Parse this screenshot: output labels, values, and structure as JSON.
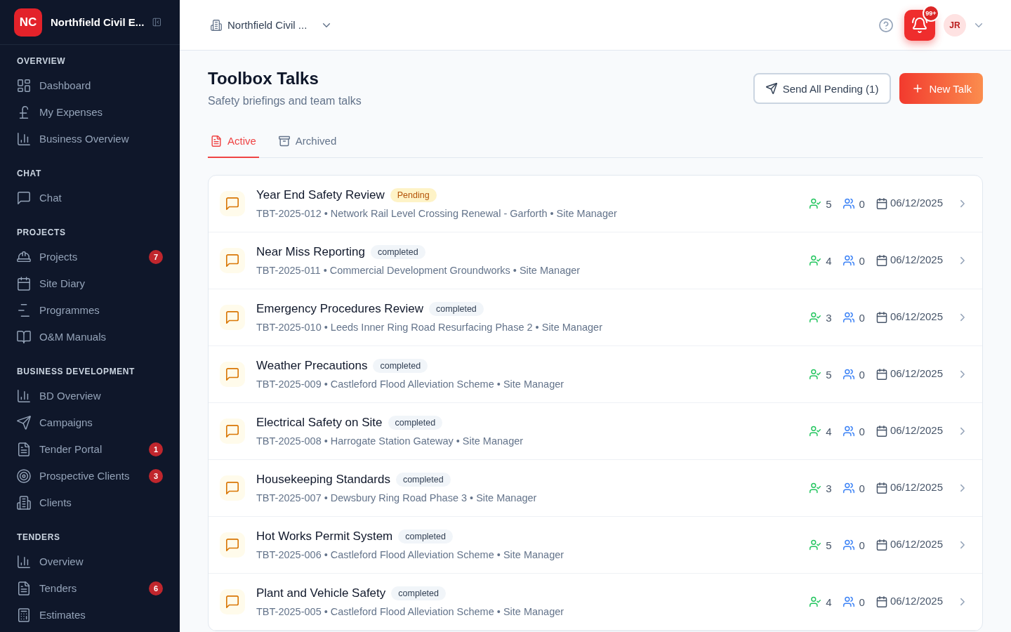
{
  "sidebar": {
    "brand": {
      "initials": "NC",
      "name": "Northfield Civil E..."
    },
    "sections": [
      {
        "heading": "OVERVIEW",
        "items": [
          {
            "label": "Dashboard"
          },
          {
            "label": "My Expenses"
          },
          {
            "label": "Business Overview"
          }
        ]
      },
      {
        "heading": "CHAT",
        "items": [
          {
            "label": "Chat"
          }
        ]
      },
      {
        "heading": "PROJECTS",
        "items": [
          {
            "label": "Projects",
            "badge": "7"
          },
          {
            "label": "Site Diary"
          },
          {
            "label": "Programmes"
          },
          {
            "label": "O&M Manuals"
          }
        ]
      },
      {
        "heading": "BUSINESS DEVELOPMENT",
        "items": [
          {
            "label": "BD Overview"
          },
          {
            "label": "Campaigns"
          },
          {
            "label": "Tender Portal",
            "badge": "1"
          },
          {
            "label": "Prospective Clients",
            "badge": "3"
          },
          {
            "label": "Clients"
          }
        ]
      },
      {
        "heading": "TENDERS",
        "items": [
          {
            "label": "Overview"
          },
          {
            "label": "Tenders",
            "badge": "6"
          },
          {
            "label": "Estimates"
          }
        ]
      }
    ]
  },
  "topbar": {
    "workspace": "Northfield Civil ...",
    "notification_count": "99+",
    "user_initials": "JR"
  },
  "page": {
    "title": "Toolbox Talks",
    "subtitle": "Safety briefings and team talks",
    "actions": [
      {
        "label": "Send All Pending (1)",
        "kind": "secondary"
      },
      {
        "label": "New Talk",
        "kind": "primary"
      }
    ]
  },
  "tabs": [
    {
      "label": "Active",
      "selected": true
    },
    {
      "label": "Archived",
      "selected": false
    }
  ],
  "talks": [
    {
      "title": "Year End Safety Review",
      "status": {
        "label": "Pending",
        "kind": "pending"
      },
      "meta": "TBT-2025-012 • Network Rail Level Crossing Renewal - Garforth • Site Manager",
      "user_check_count": "5",
      "users_count": "0",
      "date": "06/12/2025"
    },
    {
      "title": "Near Miss Reporting",
      "status": {
        "label": "completed",
        "kind": "completed"
      },
      "meta": "TBT-2025-011 • Commercial Development Groundworks • Site Manager",
      "user_check_count": "4",
      "users_count": "0",
      "date": "06/12/2025"
    },
    {
      "title": "Emergency Procedures Review",
      "status": {
        "label": "completed",
        "kind": "completed"
      },
      "meta": "TBT-2025-010 • Leeds Inner Ring Road Resurfacing Phase 2 • Site Manager",
      "user_check_count": "3",
      "users_count": "0",
      "date": "06/12/2025"
    },
    {
      "title": "Weather Precautions",
      "status": {
        "label": "completed",
        "kind": "completed"
      },
      "meta": "TBT-2025-009 • Castleford Flood Alleviation Scheme • Site Manager",
      "user_check_count": "5",
      "users_count": "0",
      "date": "06/12/2025"
    },
    {
      "title": "Electrical Safety on Site",
      "status": {
        "label": "completed",
        "kind": "completed"
      },
      "meta": "TBT-2025-008 • Harrogate Station Gateway • Site Manager",
      "user_check_count": "4",
      "users_count": "0",
      "date": "06/12/2025"
    },
    {
      "title": "Housekeeping Standards",
      "status": {
        "label": "completed",
        "kind": "completed"
      },
      "meta": "TBT-2025-007 • Dewsbury Ring Road Phase 3 • Site Manager",
      "user_check_count": "3",
      "users_count": "0",
      "date": "06/12/2025"
    },
    {
      "title": "Hot Works Permit System",
      "status": {
        "label": "completed",
        "kind": "completed"
      },
      "meta": "TBT-2025-006 • Castleford Flood Alleviation Scheme • Site Manager",
      "user_check_count": "5",
      "users_count": "0",
      "date": "06/12/2025"
    },
    {
      "title": "Plant and Vehicle Safety",
      "status": {
        "label": "completed",
        "kind": "completed"
      },
      "meta": "TBT-2025-005 • Castleford Flood Alleviation Scheme • Site Manager",
      "user_check_count": "4",
      "users_count": "0",
      "date": "06/12/2025"
    }
  ]
}
